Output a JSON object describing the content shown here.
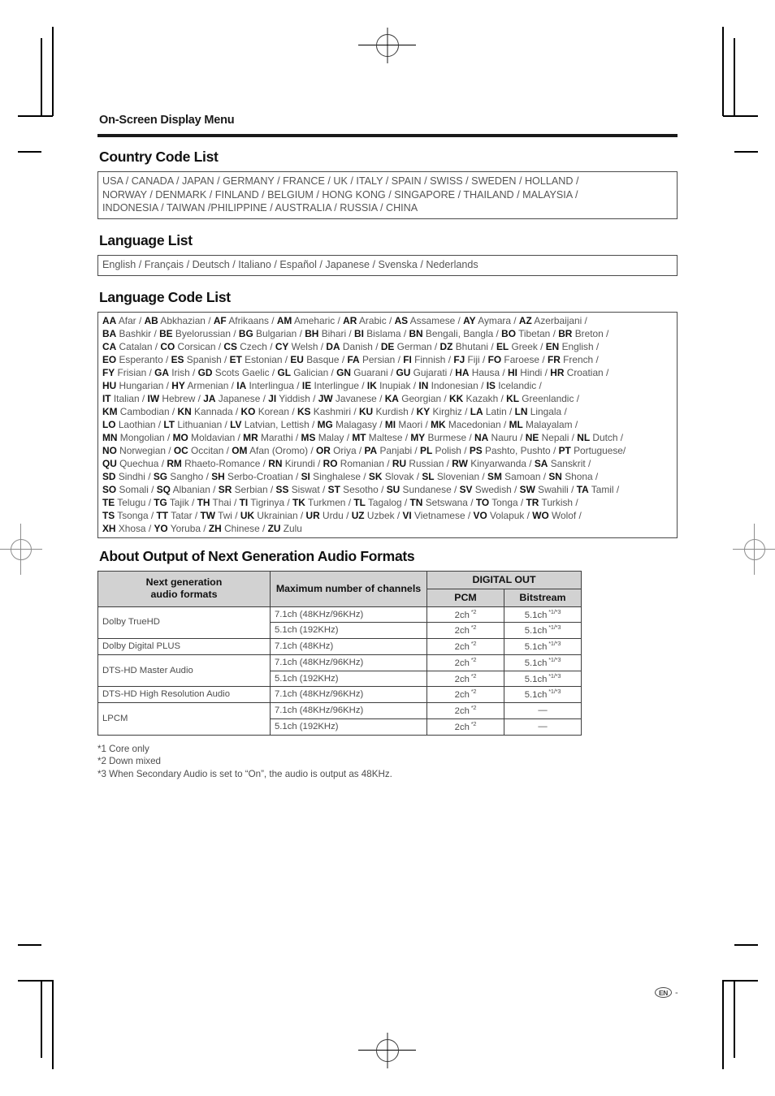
{
  "running_head": "On-Screen Display Menu",
  "sections": {
    "country": {
      "title": "Country Code List",
      "lines": [
        "USA / CANADA / JAPAN / GERMANY / FRANCE / UK / ITALY / SPAIN / SWISS / SWEDEN / HOLLAND /",
        "NORWAY / DENMARK / FINLAND / BELGIUM / HONG KONG / SINGAPORE / THAILAND / MALAYSIA /",
        "INDONESIA / TAIWAN /PHILIPPINE / AUSTRALIA / RUSSIA / CHINA"
      ]
    },
    "language": {
      "title": "Language List",
      "lines": [
        "English / Français / Deutsch / Italiano / Español / Japanese / Svenska / Nederlands"
      ]
    },
    "language_code": {
      "title": "Language Code List",
      "lines": [
        "<b>AA</b> Afar / <b>AB</b> Abkhazian / <b>AF</b> Afrikaans / <b>AM</b> Ameharic / <b>AR</b> Arabic / <b>AS</b> Assamese / <b>AY</b> Aymara / <b>AZ</b> Azerbaijani /",
        "<b>BA</b> Bashkir / <b>BE</b> Byelorussian / <b>BG</b> Bulgarian / <b>BH</b> Bihari / <b>BI</b> Bislama / <b>BN</b> Bengali, Bangla / <b>BO</b> Tibetan / <b>BR</b> Breton /",
        "<b>CA</b> Catalan / <b>CO</b> Corsican / <b>CS</b> Czech / <b>CY</b> Welsh / <b>DA</b> Danish / <b>DE</b> German / <b>DZ</b> Bhutani / <b>EL</b> Greek / <b>EN</b> English /",
        "<b>EO</b> Esperanto / <b>ES</b> Spanish / <b>ET</b> Estonian / <b>EU</b> Basque / <b>FA</b> Persian / <b>FI</b> Finnish / <b>FJ</b> Fiji / <b>FO</b> Faroese / <b>FR</b> French /",
        "<b>FY</b> Frisian / <b>GA</b> Irish / <b>GD</b> Scots Gaelic / <b>GL</b> Galician / <b>GN</b> Guarani / <b>GU</b> Gujarati / <b>HA</b> Hausa / <b>HI</b> Hindi / <b>HR</b> Croatian /",
        "<b>HU</b> Hungarian / <b>HY</b> Armenian / <b>IA</b> Interlingua / <b>IE</b> Interlingue / <b>IK</b> Inupiak / <b>IN</b> Indonesian / <b>IS</b> Icelandic /",
        "<b>IT</b> Italian / <b>IW</b> Hebrew / <b>JA</b> Japanese / <b>JI</b> Yiddish / <b>JW</b> Javanese / <b>KA</b> Georgian / <b>KK</b> Kazakh / <b>KL</b> Greenlandic /",
        "<b>KM</b> Cambodian / <b>KN</b> Kannada / <b>KO</b> Korean / <b>KS</b> Kashmiri / <b>KU</b> Kurdish / <b>KY</b> Kirghiz / <b>LA</b> Latin / <b>LN</b> Lingala /",
        "<b>LO</b> Laothian / <b>LT</b> Lithuanian / <b>LV</b> Latvian, Lettish / <b>MG</b> Malagasy / <b>MI</b> Maori / <b>MK</b> Macedonian / <b>ML</b> Malayalam /",
        "<b>MN</b> Mongolian / <b>MO</b> Moldavian / <b>MR</b> Marathi / <b>MS</b> Malay / <b>MT</b> Maltese / <b>MY</b> Burmese / <b>NA</b> Nauru / <b>NE</b> Nepali / <b>NL</b> Dutch /",
        "<b>NO</b> Norwegian / <b>OC</b> Occitan / <b>OM</b> Afan (Oromo) / <b>OR</b> Oriya / <b>PA</b> Panjabi / <b>PL</b> Polish / <b>PS</b> Pashto, Pushto / <b>PT</b> Portuguese/",
        "<b>QU</b> Quechua / <b>RM</b> Rhaeto-Romance / <b>RN</b> Kirundi / <b>RO</b> Romanian / <b>RU</b> Russian / <b>RW</b> Kinyarwanda / <b>SA</b> Sanskrit /",
        "<b>SD</b> Sindhi / <b>SG</b> Sangho / <b>SH</b> Serbo-Croatian / <b>SI</b> Singhalese / <b>SK</b> Slovak / <b>SL</b> Slovenian / <b>SM</b> Samoan / <b>SN</b> Shona /",
        "<b>SO</b> Somali / <b>SQ</b> Albanian / <b>SR</b> Serbian / <b>SS</b> Siswat / <b>ST</b> Sesotho / <b>SU</b> Sundanese / <b>SV</b> Swedish / <b>SW</b> Swahili / <b>TA</b> Tamil /",
        "<b>TE</b> Telugu / <b>TG</b> Tajik / <b>TH</b> Thai / <b>TI</b> Tigrinya / <b>TK</b> Turkmen / <b>TL</b> Tagalog / <b>TN</b> Setswana / <b>TO</b> Tonga / <b>TR</b> Turkish /",
        "<b>TS</b> Tsonga / <b>TT</b> Tatar / <b>TW</b> Twi / <b>UK</b> Ukrainian / <b>UR</b> Urdu / <b>UZ</b> Uzbek / <b>VI</b> Vietnamese / <b>VO</b> Volapuk / <b>WO</b> Wolof /",
        "<b>XH</b> Xhosa / <b>YO</b> Yoruba / <b>ZH</b> Chinese / <b>ZU</b> Zulu"
      ]
    },
    "audio": {
      "title": "About Output of Next Generation Audio Formats",
      "headers": {
        "formats": "Next generation\naudio formats",
        "formats_line1": "Next generation",
        "formats_line2": "audio formats",
        "channels": "Maximum number of channels",
        "digital_out": "DIGITAL OUT",
        "pcm": "PCM",
        "bitstream": "Bitstream"
      },
      "rows": [
        {
          "format": "Dolby TrueHD",
          "rowspan": 2,
          "channels": "7.1ch (48KHz/96KHz)",
          "pcm": "2ch",
          "pcm_sup": "*2",
          "bitstream": "5.1ch",
          "bitstream_sup": "*1/*3"
        },
        {
          "format": null,
          "channels": "5.1ch (192KHz)",
          "pcm": "2ch",
          "pcm_sup": "*2",
          "bitstream": "5.1ch",
          "bitstream_sup": "*1/*3"
        },
        {
          "format": "Dolby Digital PLUS",
          "rowspan": 1,
          "channels": "7.1ch (48KHz)",
          "pcm": "2ch",
          "pcm_sup": "*2",
          "bitstream": "5.1ch",
          "bitstream_sup": "*1/*3"
        },
        {
          "format": "DTS-HD Master Audio",
          "rowspan": 2,
          "channels": "7.1ch (48KHz/96KHz)",
          "pcm": "2ch",
          "pcm_sup": "*2",
          "bitstream": "5.1ch",
          "bitstream_sup": "*1/*3"
        },
        {
          "format": null,
          "channels": "5.1ch (192KHz)",
          "pcm": "2ch",
          "pcm_sup": "*2",
          "bitstream": "5.1ch",
          "bitstream_sup": "*1/*3"
        },
        {
          "format": "DTS-HD High Resolution Audio",
          "rowspan": 1,
          "channels": "7.1ch (48KHz/96KHz)",
          "pcm": "2ch",
          "pcm_sup": "*2",
          "bitstream": "5.1ch",
          "bitstream_sup": "*1/*3"
        },
        {
          "format": "LPCM",
          "rowspan": 2,
          "channels": "7.1ch (48KHz/96KHz)",
          "pcm": "2ch",
          "pcm_sup": "*2",
          "bitstream": "—",
          "bitstream_sup": ""
        },
        {
          "format": null,
          "channels": "5.1ch (192KHz)",
          "pcm": "2ch",
          "pcm_sup": "*2",
          "bitstream": "—",
          "bitstream_sup": ""
        }
      ],
      "notes": [
        "*1 Core only",
        "*2 Down mixed",
        "*3 When Secondary Audio is set to “On”, the audio is output as 48KHz."
      ]
    }
  },
  "footer": {
    "language_badge": "EN",
    "page_dash": "-"
  }
}
